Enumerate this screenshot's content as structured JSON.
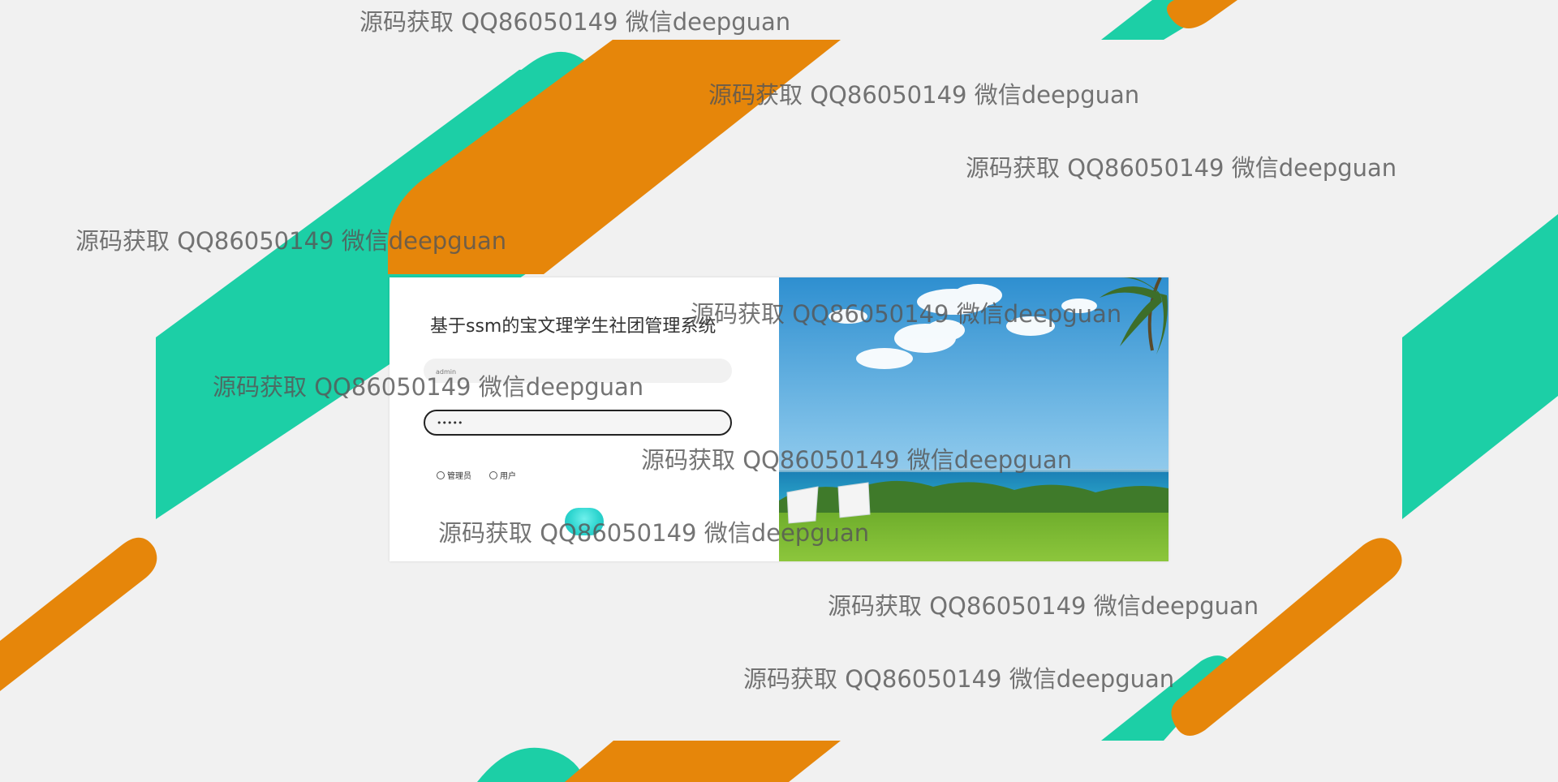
{
  "colors": {
    "background": "#f1f1f1",
    "teal": "#1ccfa6",
    "orange": "#e6860a",
    "button": "#2fd6d0"
  },
  "login": {
    "title": "基于ssm的宝文理学生社团管理系统",
    "username_value": "admin",
    "password_value": "•••••",
    "roles": [
      {
        "label": "管理员",
        "checked": false
      },
      {
        "label": "用户",
        "checked": false
      }
    ],
    "login_button_label": "",
    "scene_image": "beach-lawn-with-chairs"
  },
  "watermark": {
    "text": "源码获取 QQ86050149 微信deepguan"
  },
  "icons": [
    "radio-icon"
  ]
}
